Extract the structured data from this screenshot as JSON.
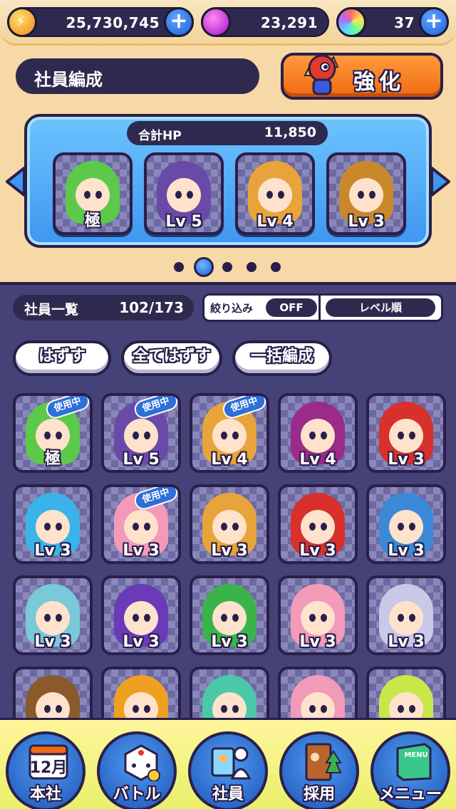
{
  "currency": {
    "coins": "25,730,745",
    "drops": "23,291",
    "gems": "37"
  },
  "header": {
    "title": "社員編成",
    "enhance_label": "強化"
  },
  "team": {
    "hp_label": "合計HP",
    "hp_value": "11,850",
    "members": [
      {
        "level": "極",
        "hair": "#5dc94a",
        "bg": "#3f96f0"
      },
      {
        "level": "Lv 5",
        "hair": "#6a4aa8",
        "bg": "#3f96f0"
      },
      {
        "level": "Lv 4",
        "hair": "#e8a43a",
        "bg": "#3f96f0"
      },
      {
        "level": "Lv 3",
        "hair": "#c9882a",
        "bg": "#3f96f0"
      }
    ],
    "page_count": 5,
    "active_page": 1
  },
  "list": {
    "count_label": "社員一覧",
    "count_value": "102/173",
    "filter_label": "絞り込み",
    "filter_value": "OFF",
    "sort_label": "レベル順",
    "buttons": [
      "はずす",
      "全てはずす",
      "一括編成"
    ],
    "in_use_label": "使用中",
    "cards": [
      {
        "level": "極",
        "in_use": true,
        "hair": "#5dc94a"
      },
      {
        "level": "Lv 5",
        "in_use": true,
        "hair": "#6a4aa8"
      },
      {
        "level": "Lv 4",
        "in_use": true,
        "hair": "#e8a43a"
      },
      {
        "level": "Lv 4",
        "in_use": false,
        "hair": "#9b2a8a"
      },
      {
        "level": "Lv 3",
        "in_use": false,
        "hair": "#d8302a"
      },
      {
        "level": "Lv 3",
        "in_use": false,
        "hair": "#3ab4e8"
      },
      {
        "level": "Lv 3",
        "in_use": true,
        "hair": "#f29ab8"
      },
      {
        "level": "Lv 3",
        "in_use": false,
        "hair": "#e8a43a"
      },
      {
        "level": "Lv 3",
        "in_use": false,
        "hair": "#d8302a"
      },
      {
        "level": "Lv 3",
        "in_use": false,
        "hair": "#3a8ad8"
      },
      {
        "level": "Lv 3",
        "in_use": false,
        "hair": "#7ac8d8"
      },
      {
        "level": "Lv 3",
        "in_use": false,
        "hair": "#6a3ab8"
      },
      {
        "level": "Lv 3",
        "in_use": false,
        "hair": "#3ab44a"
      },
      {
        "level": "Lv 3",
        "in_use": false,
        "hair": "#f29ab8"
      },
      {
        "level": "Lv 3",
        "in_use": false,
        "hair": "#c8c8e8"
      },
      {
        "level": "",
        "in_use": false,
        "hair": "#8a5a2a"
      },
      {
        "level": "",
        "in_use": false,
        "hair": "#f0a020"
      },
      {
        "level": "",
        "in_use": false,
        "hair": "#4ac8a8"
      },
      {
        "level": "",
        "in_use": false,
        "hair": "#f29ab8"
      },
      {
        "level": "",
        "in_use": false,
        "hair": "#c8e84a"
      }
    ]
  },
  "nav": [
    {
      "label": "本社",
      "icon": "calendar-icon",
      "icon_text": "12月"
    },
    {
      "label": "バトル",
      "icon": "dice-icon"
    },
    {
      "label": "社員",
      "icon": "employee-icon"
    },
    {
      "label": "採用",
      "icon": "door-icon"
    },
    {
      "label": "メニュー",
      "icon": "menu-book-icon",
      "icon_text": "MENU"
    }
  ]
}
